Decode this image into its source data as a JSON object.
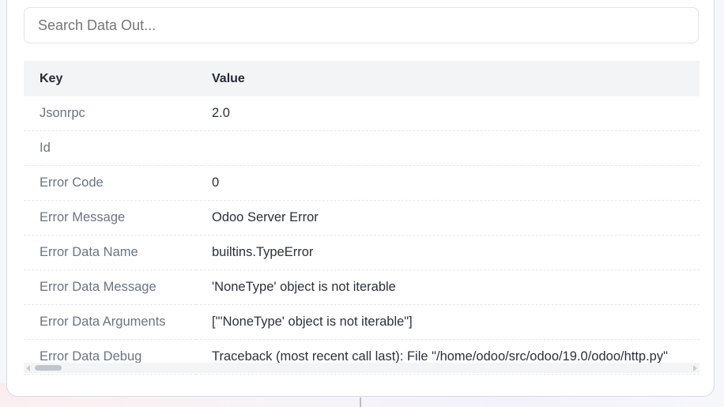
{
  "search": {
    "placeholder": "Search Data Out..."
  },
  "table": {
    "headers": {
      "key": "Key",
      "value": "Value"
    },
    "rows": [
      {
        "key": "Jsonrpc",
        "value": "2.0"
      },
      {
        "key": "Id",
        "value": ""
      },
      {
        "key": "Error Code",
        "value": "0"
      },
      {
        "key": "Error Message",
        "value": "Odoo Server Error"
      },
      {
        "key": "Error Data Name",
        "value": "builtins.TypeError"
      },
      {
        "key": "Error Data Message",
        "value": "'NoneType' object is not iterable"
      },
      {
        "key": "Error Data Arguments",
        "value": "[\"'NoneType' object is not iterable\"]"
      },
      {
        "key": "Error Data Debug",
        "value": "Traceback (most recent call last): File \"/home/odoo/src/odoo/19.0/odoo/http.py\""
      }
    ]
  },
  "colors": {
    "border": "#d5dbe6",
    "header_bg": "#f3f4f6",
    "key_text": "#6b7482",
    "value_text": "#2b313c"
  }
}
